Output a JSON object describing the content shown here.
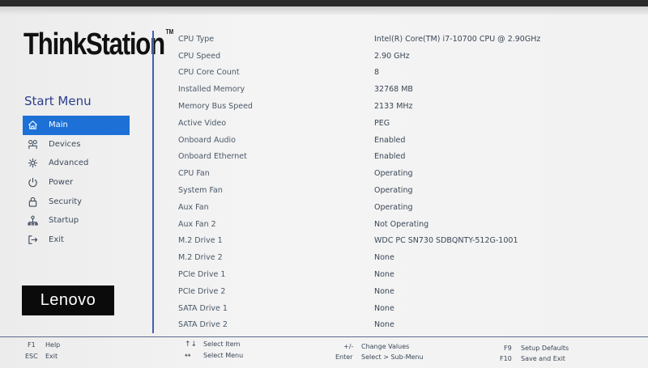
{
  "brand": {
    "product_logo": "ThinkStation",
    "tm": "TM",
    "vendor_logo": "Lenovo"
  },
  "sidebar": {
    "title": "Start Menu",
    "items": [
      {
        "label": "Main",
        "icon": "home-icon"
      },
      {
        "label": "Devices",
        "icon": "devices-icon"
      },
      {
        "label": "Advanced",
        "icon": "advanced-icon"
      },
      {
        "label": "Power",
        "icon": "power-icon"
      },
      {
        "label": "Security",
        "icon": "lock-icon"
      },
      {
        "label": "Startup",
        "icon": "startup-icon"
      },
      {
        "label": "Exit",
        "icon": "exit-icon"
      }
    ],
    "selected": "Main"
  },
  "info": [
    {
      "label": "CPU Type",
      "value": "Intel(R) Core(TM) i7-10700 CPU @ 2.90GHz"
    },
    {
      "label": "CPU Speed",
      "value": "2.90 GHz"
    },
    {
      "label": "CPU Core Count",
      "value": "8"
    },
    {
      "label": "Installed Memory",
      "value": "32768 MB"
    },
    {
      "label": "Memory Bus Speed",
      "value": "2133 MHz"
    },
    {
      "label": "Active Video",
      "value": "PEG"
    },
    {
      "label": "Onboard Audio",
      "value": "Enabled"
    },
    {
      "label": "Onboard Ethernet",
      "value": "Enabled"
    },
    {
      "label": "CPU Fan",
      "value": "Operating"
    },
    {
      "label": "System Fan",
      "value": "Operating"
    },
    {
      "label": "Aux Fan",
      "value": "Operating"
    },
    {
      "label": "Aux Fan 2",
      "value": "Not Operating"
    },
    {
      "label": "M.2 Drive 1",
      "value": "WDC PC SN730 SDBQNTY-512G-1001"
    },
    {
      "label": "M.2 Drive 2",
      "value": "None"
    },
    {
      "label": "PCIe Drive 1",
      "value": "None"
    },
    {
      "label": "PCIe Drive 2",
      "value": "None"
    },
    {
      "label": "SATA Drive 1",
      "value": "None"
    },
    {
      "label": "SATA Drive 2",
      "value": "None"
    }
  ],
  "help": {
    "f1_key": "F1",
    "f1_label": "Help",
    "esc_key": "ESC",
    "esc_label": "Exit",
    "updown_key": "↑↓",
    "updown_label": "Select Item",
    "leftright_key": "↔",
    "leftright_label": "Select Menu",
    "plusminus_key": "+/-",
    "plusminus_label": "Change Values",
    "enter_key": "Enter",
    "enter_label": "Select > Sub-Menu",
    "f9_key": "F9",
    "f9_label": "Setup Defaults",
    "f10_key": "F10",
    "f10_label": "Save and Exit"
  },
  "colors": {
    "accent": "#1d70d6",
    "title": "#2b3d8c",
    "divider": "#3f63ad"
  }
}
